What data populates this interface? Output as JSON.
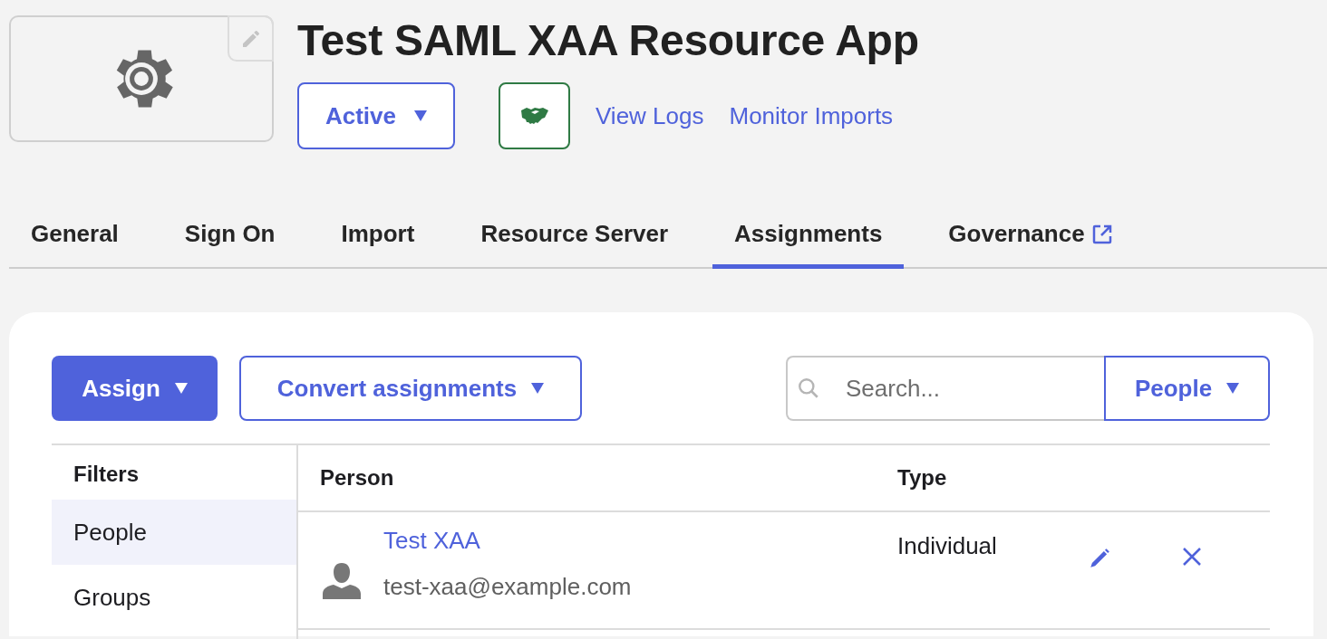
{
  "app": {
    "title": "Test SAML XAA Resource App",
    "status_button": "Active",
    "links": [
      "View Logs",
      "Monitor Imports"
    ]
  },
  "tabs": [
    {
      "label": "General",
      "selected": false,
      "external": false
    },
    {
      "label": "Sign On",
      "selected": false,
      "external": false
    },
    {
      "label": "Import",
      "selected": false,
      "external": false
    },
    {
      "label": "Resource Server",
      "selected": false,
      "external": false
    },
    {
      "label": "Assignments",
      "selected": true,
      "external": false
    },
    {
      "label": "Governance",
      "selected": false,
      "external": true
    }
  ],
  "toolbar": {
    "assign": "Assign",
    "convert": "Convert assignments",
    "search": {
      "placeholder": "Search..."
    },
    "scope": "People"
  },
  "filters": {
    "title": "Filters",
    "items": [
      {
        "label": "People",
        "selected": true
      },
      {
        "label": "Groups",
        "selected": false
      }
    ]
  },
  "table": {
    "columns": [
      "Person",
      "Type"
    ],
    "rows": [
      {
        "name": "Test XAA",
        "email": "test-xaa@example.com",
        "type": "Individual"
      }
    ]
  }
}
